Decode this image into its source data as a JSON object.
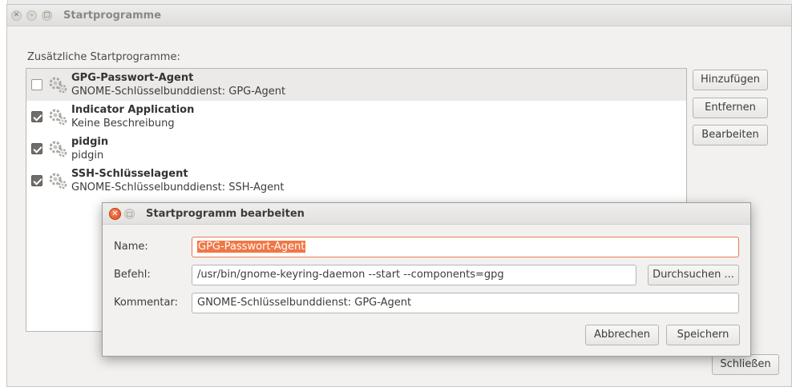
{
  "main_window": {
    "title": "Startprogramme",
    "section_label": "Zusätzliche Startprogramme:",
    "items": [
      {
        "name": "GPG-Passwort-Agent",
        "description": "GNOME-Schlüsselbunddienst: GPG-Agent",
        "enabled": false
      },
      {
        "name": "Indicator Application",
        "description": "Keine Beschreibung",
        "enabled": true
      },
      {
        "name": "pidgin",
        "description": "pidgin",
        "enabled": true
      },
      {
        "name": "SSH-Schlüsselagent",
        "description": "GNOME-Schlüsselbunddienst: SSH-Agent",
        "enabled": true
      }
    ],
    "buttons": {
      "add": "Hinzufügen",
      "remove": "Entfernen",
      "edit": "Bearbeiten",
      "close": "Schließen"
    }
  },
  "dialog": {
    "title": "Startprogramm bearbeiten",
    "name_label": "Name:",
    "name_value": "GPG-Passwort-Agent",
    "command_label": "Befehl:",
    "command_value": "/usr/bin/gnome-keyring-daemon --start --components=gpg",
    "browse_button": "Durchsuchen ...",
    "comment_label": "Kommentar:",
    "comment_value": "GNOME-Schlüsselbunddienst: GPG-Agent",
    "cancel_button": "Abbrechen",
    "save_button": "Speichern"
  },
  "colors": {
    "accent": "#f07746",
    "close_button": "#df4b16",
    "checkbox_checked": "#706d6a"
  }
}
